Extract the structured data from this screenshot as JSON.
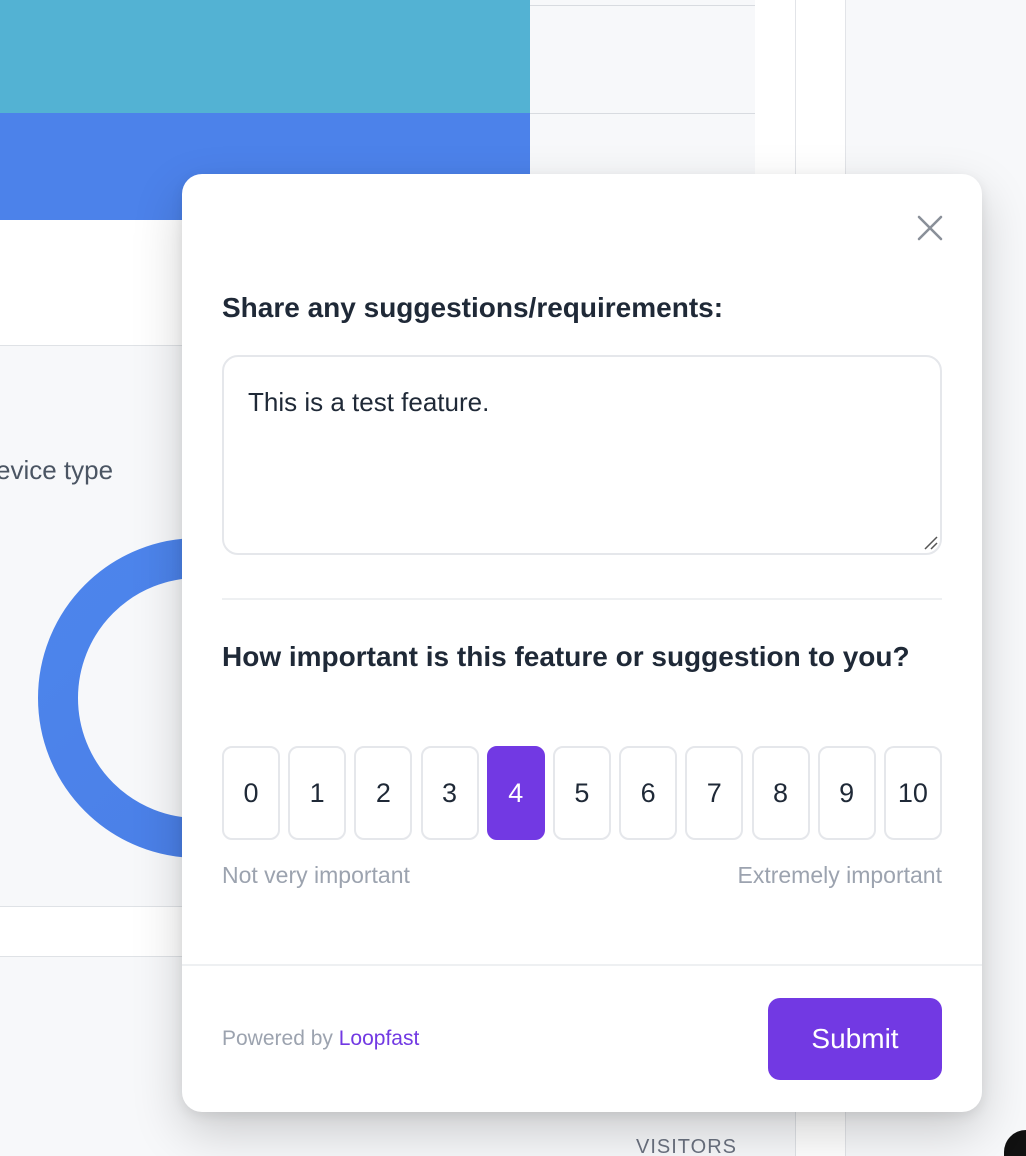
{
  "background": {
    "device_label": "evice type",
    "visitors_label": "VISITORS"
  },
  "modal": {
    "question_suggestions": "Share any suggestions/requirements:",
    "textarea_value": "This is a test feature.",
    "question_importance": "How important is this feature or suggestion to you?",
    "scale": {
      "options": [
        "0",
        "1",
        "2",
        "3",
        "4",
        "5",
        "6",
        "7",
        "8",
        "9",
        "10"
      ],
      "selected": "4",
      "low_label": "Not very important",
      "high_label": "Extremely important"
    },
    "footer": {
      "powered_by": "Powered by",
      "brand": "Loopfast",
      "submit_label": "Submit"
    },
    "icons": {
      "close": "close-icon",
      "resize": "resize-grip-icon"
    }
  },
  "colors": {
    "accent": "#7239e3",
    "bar_teal": "#53b2d3",
    "bar_blue": "#4c82ea"
  }
}
